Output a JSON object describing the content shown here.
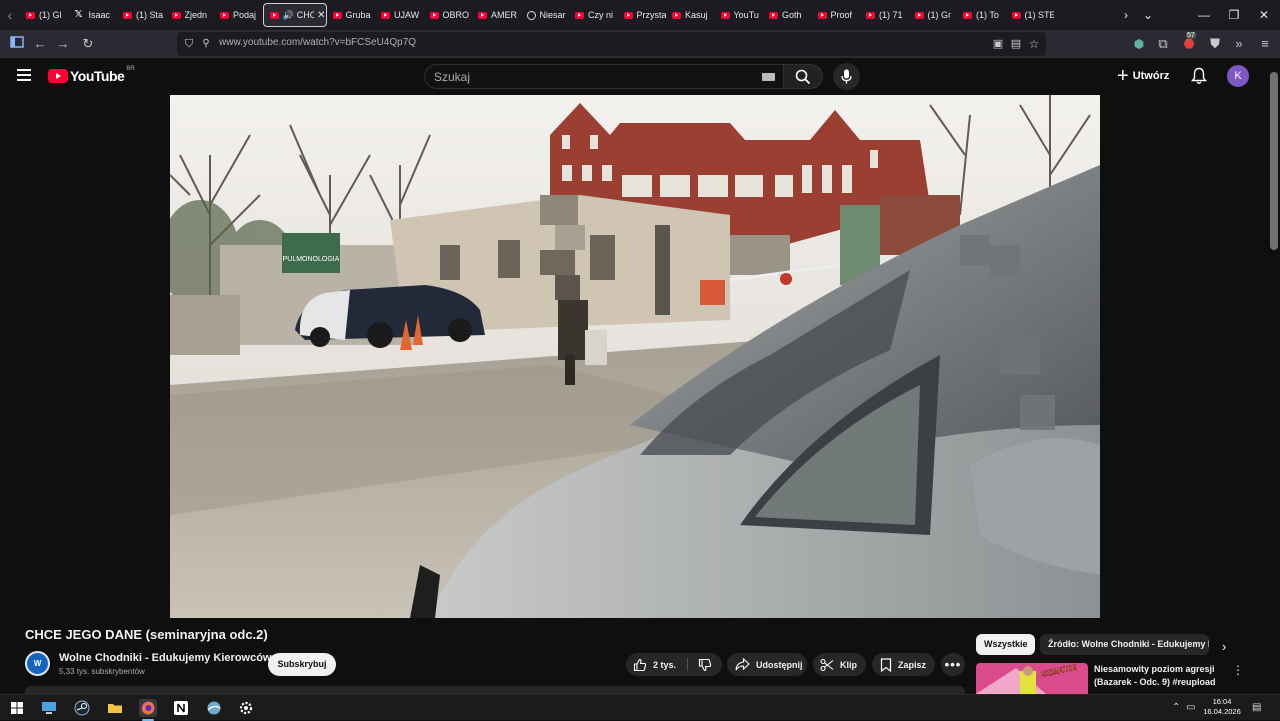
{
  "browser": {
    "tabs": [
      {
        "label": "(1) Gl",
        "icon": "youtube-icon"
      },
      {
        "label": "Isaac",
        "icon": "x-icon"
      },
      {
        "label": "(1) Sta",
        "icon": "youtube-icon"
      },
      {
        "label": "Zjedn",
        "icon": "youtube-icon"
      },
      {
        "label": "Podaj",
        "icon": "youtube-icon"
      },
      {
        "label": "CHC",
        "icon": "youtube-icon",
        "active": true,
        "audio": true
      },
      {
        "label": "Gruba",
        "icon": "youtube-icon"
      },
      {
        "label": "UJAW",
        "icon": "youtube-icon"
      },
      {
        "label": "OBRO",
        "icon": "youtube-icon"
      },
      {
        "label": "AMER",
        "icon": "youtube-icon"
      },
      {
        "label": "Niesar",
        "icon": "circle-play-icon"
      },
      {
        "label": "Czy ni",
        "icon": "youtube-icon"
      },
      {
        "label": "Przysta",
        "icon": "youtube-icon"
      },
      {
        "label": "Kasuj",
        "icon": "youtube-icon"
      },
      {
        "label": "YouTu",
        "icon": "youtube-icon"
      },
      {
        "label": "Goth",
        "icon": "youtube-icon"
      },
      {
        "label": "Proof",
        "icon": "youtube-icon"
      },
      {
        "label": "(1) 71",
        "icon": "youtube-icon"
      },
      {
        "label": "(1) Gr",
        "icon": "youtube-icon"
      },
      {
        "label": "(1) To",
        "icon": "youtube-icon"
      },
      {
        "label": "(1) STE",
        "icon": "youtube-icon"
      }
    ],
    "url": "www.youtube.com/watch?v=bFCSeU4Qp7Q",
    "extension_badge": "57"
  },
  "youtube": {
    "logo_text": "YouTube",
    "country_code": "BR",
    "search_placeholder": "Szukaj",
    "create_label": "Utwórz",
    "avatar_letter": "K"
  },
  "video": {
    "title": "CHCE JEGO DANE (seminaryjna odc.2)",
    "scene_sign": "PULMONOLOGIA",
    "channel_name": "Wolne Chodniki - Edukujemy Kierowców",
    "channel_avatar_text": "W",
    "subscribers": "5,33 tys. subskrybentów",
    "subscribe_label": "Subskrybuj",
    "likes": "2 tys.",
    "share_label": "Udostępnij",
    "clip_label": "Klip",
    "save_label": "Zapisz"
  },
  "sidebar": {
    "chips": [
      "Wszystkie",
      "Źródło: Wolne Chodniki - Edukujemy Ki"
    ],
    "recommendation": {
      "title": "Niesamowity poziom agresji (Bazarek - Odc. 9) #reupload",
      "thumb_text": "SZMATO!"
    }
  },
  "taskbar": {
    "time": "16:04",
    "date": "16.04.2026"
  },
  "colors": {
    "youtube_red": "#ff0033",
    "background": "#0f0f0f",
    "avatar": "#7e57c2"
  }
}
